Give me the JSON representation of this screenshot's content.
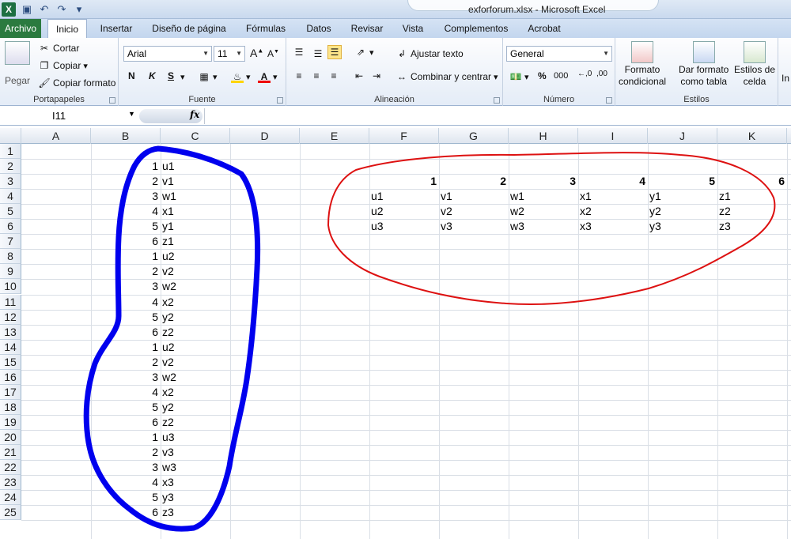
{
  "window": {
    "title": "exforforum.xlsx - Microsoft Excel"
  },
  "qat": {
    "icons": [
      "excel-logo",
      "save-icon",
      "undo-icon",
      "redo-icon",
      "customize-icon"
    ]
  },
  "tabs": [
    "Archivo",
    "Inicio",
    "Insertar",
    "Diseño de página",
    "Fórmulas",
    "Datos",
    "Revisar",
    "Vista",
    "Complementos",
    "Acrobat"
  ],
  "ribbon": {
    "clipboard": {
      "label": "Portapapeles",
      "paste": "Pegar",
      "cut": "Cortar",
      "copy": "Copiar",
      "format_painter": "Copiar formato"
    },
    "font": {
      "label": "Fuente",
      "name": "Arial",
      "size": "11",
      "bold": "N",
      "italic": "K",
      "underline": "S"
    },
    "alignment": {
      "label": "Alineación",
      "wrap": "Ajustar texto",
      "merge": "Combinar y centrar"
    },
    "number": {
      "label": "Número",
      "format": "General",
      "percent": "%",
      "thousands": "000"
    },
    "styles": {
      "label": "Estilos",
      "conditional": [
        "Formato",
        "condicional"
      ],
      "table": [
        "Dar formato",
        "como tabla"
      ],
      "cell": [
        "Estilos de",
        "celda"
      ],
      "insert_partial": "In"
    }
  },
  "formula_bar": {
    "name_box": "I11",
    "fx": "fx",
    "value": ""
  },
  "columns": [
    "A",
    "B",
    "C",
    "D",
    "E",
    "F",
    "G",
    "H",
    "I",
    "J",
    "K"
  ],
  "rows": [
    "1",
    "2",
    "3",
    "4",
    "5",
    "6",
    "7",
    "8",
    "9",
    "10",
    "11",
    "12",
    "13",
    "14",
    "15",
    "16",
    "17",
    "18",
    "19",
    "20",
    "21",
    "22",
    "23",
    "24",
    "25"
  ],
  "list": {
    "numbers": [
      "1",
      "2",
      "3",
      "4",
      "5",
      "6",
      "1",
      "2",
      "3",
      "4",
      "5",
      "6",
      "1",
      "2",
      "3",
      "4",
      "5",
      "6",
      "1",
      "2",
      "3",
      "4",
      "5",
      "6"
    ],
    "labels": [
      "u1",
      "v1",
      "w1",
      "x1",
      "y1",
      "z1",
      "u2",
      "v2",
      "w2",
      "x2",
      "y2",
      "z2",
      "u2",
      "v2",
      "w2",
      "x2",
      "y2",
      "z2",
      "u3",
      "v3",
      "w3",
      "x3",
      "y3",
      "z3"
    ]
  },
  "table": {
    "headers": [
      "1",
      "2",
      "3",
      "4",
      "5",
      "6"
    ],
    "rows": [
      [
        "u1",
        "v1",
        "w1",
        "x1",
        "y1",
        "z1"
      ],
      [
        "u2",
        "v2",
        "w2",
        "x2",
        "y2",
        "z2"
      ],
      [
        "u3",
        "v3",
        "w3",
        "x3",
        "y3",
        "z3"
      ]
    ]
  },
  "colors": {
    "blue_annotation": "#0000ee",
    "red_annotation": "#dd1111",
    "archivo_tab": "#2b7a3f"
  }
}
